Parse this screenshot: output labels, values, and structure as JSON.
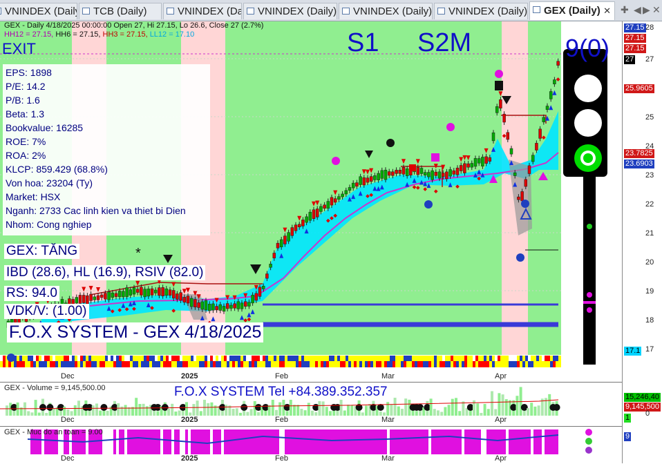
{
  "tabs": [
    {
      "label": "VNINDEX (Daily)"
    },
    {
      "label": "TCB (Daily)"
    },
    {
      "label": "VNINDEX (Daily)"
    },
    {
      "label": "VNINDEX (Daily)"
    },
    {
      "label": "VNINDEX (Daily)"
    },
    {
      "label": "VNINDEX (Daily)"
    },
    {
      "label": "GEX (Daily)",
      "active": true
    }
  ],
  "header": {
    "line1": "GEX - Daily 4/18/2025 00:00:00 Open 27, Hi 27.15, Lo 26.6, Close 27 (2.7%)",
    "hh12": "HH12 = 27.15,",
    "hh6": "HH6 = 27.15,",
    "hh3": "HH3 = 27.15,",
    "ll12": "LL12 = 17.10"
  },
  "signals": {
    "exit": "EXIT",
    "s1": "S1",
    "s2m": "S2M",
    "count": "9(0)"
  },
  "fundamentals": [
    "EPS: 1898",
    "P/E: 14.2",
    "P/B: 1.6",
    "Beta: 1.3",
    "Bookvalue: 16285",
    "ROE: 7%",
    "ROA: 2%",
    "KLCP: 859.429 (68.8%)",
    "Von hoa: 23204 (Ty)",
    "Market: HSX",
    "Nganh: 2733 Cac linh kien va thiet bi Dien",
    "Nhom: Cong nghiep"
  ],
  "indicators": {
    "trend": "GEX: TĂNG",
    "ibd": "IBD (28.6), HL (16.9), RSIV (82.0)",
    "rs": "RS: 94.0",
    "vdk": "VDK/V:  (1.00)"
  },
  "watermark": "F.O.X SYSTEM - GEX 4/18/2025",
  "contact": "F.O.X SYSTEM Tel +84.389.352.357",
  "price_axis": {
    "ticks": [
      "28",
      "27",
      "26",
      "25",
      "24",
      "23",
      "22",
      "21",
      "20",
      "19",
      "18",
      "17"
    ],
    "badges": [
      {
        "text": "27.15",
        "bg": "#1f3fbf",
        "fg": "#ffffff"
      },
      {
        "text": "27.15",
        "bg": "#d01818",
        "fg": "#ffffff"
      },
      {
        "text": "27.15",
        "bg": "#d01818",
        "fg": "#ffffff"
      },
      {
        "text": "27",
        "bg": "#000000",
        "fg": "#ffffff"
      },
      {
        "text": "25.9605",
        "bg": "#d01818",
        "fg": "#ffffff"
      },
      {
        "text": "23.7825",
        "bg": "#d01818",
        "fg": "#ffffff"
      },
      {
        "text": "23.6903",
        "bg": "#1f3fbf",
        "fg": "#ffffff"
      },
      {
        "text": "17.1",
        "bg": "#00d4ff",
        "fg": "#000000"
      }
    ]
  },
  "date_labels": [
    "Dec",
    "2025",
    "Feb",
    "Mar",
    "Apr"
  ],
  "volume_panel": {
    "label": "GEX - Volume = 9,145,500.00",
    "badges": [
      {
        "text": "15,246,40",
        "bg": "#00c000",
        "fg": "#000000"
      },
      {
        "text": "9,145,500",
        "bg": "#d01818",
        "fg": "#ffffff"
      },
      {
        "text": "1",
        "bg": "#22dd22",
        "fg": "#000000"
      }
    ],
    "tick": "0"
  },
  "safety_panel": {
    "label": "GEX - Muc do an toan = 9.00",
    "badge": "9"
  },
  "colors": {
    "green_zone": "#90ee90",
    "pink_zone": "#ffd6d6",
    "cyan_band": "#00e5ff",
    "purple_ma": "#cc33cc",
    "up": "#00aa00",
    "down": "#dd0000"
  }
}
